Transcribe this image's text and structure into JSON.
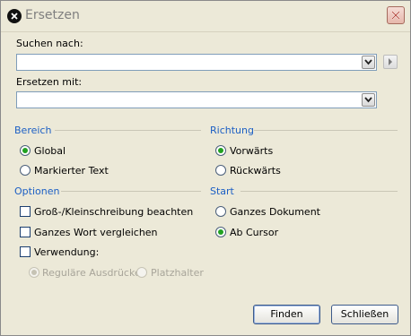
{
  "window": {
    "title": "Ersetzen"
  },
  "icons": {
    "app": "application-icon",
    "close": "close-icon",
    "dropdown": "chevron-down-icon",
    "expand": "chevron-right-icon"
  },
  "search": {
    "label": "Suchen nach:",
    "value": ""
  },
  "replace": {
    "label": "Ersetzen mit:",
    "value": ""
  },
  "bereich": {
    "title": "Bereich",
    "options": [
      {
        "label": "Global",
        "selected": true
      },
      {
        "label": "Markierter Text",
        "selected": false
      }
    ]
  },
  "richtung": {
    "title": "Richtung",
    "options": [
      {
        "label": "Vorwärts",
        "selected": true
      },
      {
        "label": "Rückwärts",
        "selected": false
      }
    ]
  },
  "optionen": {
    "title": "Optionen",
    "checks": [
      {
        "label": "Groß-/Kleinschreibung beachten",
        "checked": false
      },
      {
        "label": "Ganzes Wort vergleichen",
        "checked": false
      },
      {
        "label": "Verwendung:",
        "checked": false
      }
    ],
    "usage": [
      {
        "label": "Reguläre Ausdrücke",
        "selected": true
      },
      {
        "label": "Platzhalter",
        "selected": false
      }
    ]
  },
  "start": {
    "title": "Start",
    "options": [
      {
        "label": "Ganzes Dokument",
        "selected": false
      },
      {
        "label": "Ab Cursor",
        "selected": true
      }
    ]
  },
  "buttons": {
    "find": "Finden",
    "close": "Schließen"
  },
  "colors": {
    "section_heading": "#1c5fc4",
    "radio_selected": "#21a121",
    "dialog_bg": "#ece9d8"
  }
}
